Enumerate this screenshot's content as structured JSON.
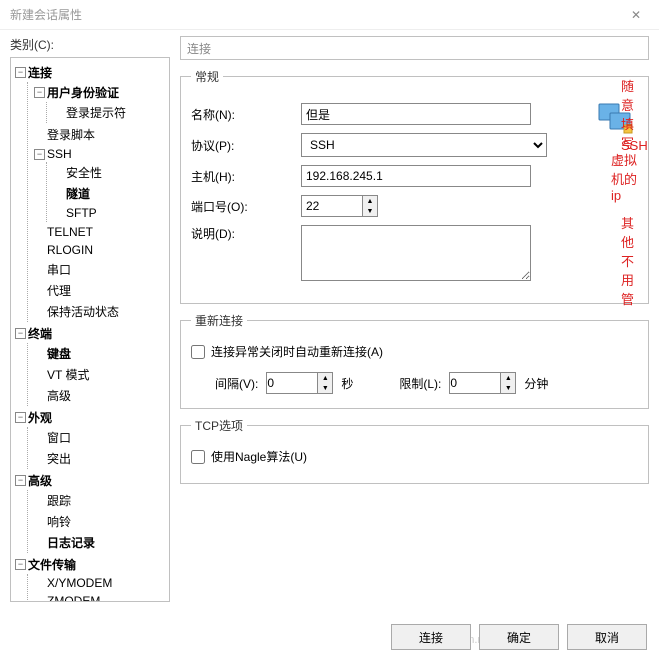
{
  "window": {
    "title": "新建会话属性",
    "close": "✕"
  },
  "sidebar": {
    "label": "类别(C):",
    "tree": {
      "connection": {
        "label": "连接",
        "auth": "用户身份验证",
        "loginPrompt": "登录提示符",
        "loginScript": "登录脚本",
        "ssh": {
          "label": "SSH",
          "security": "安全性",
          "tunnel": "隧道",
          "sftp": "SFTP"
        },
        "telnet": "TELNET",
        "rlogin": "RLOGIN",
        "serial": "串口",
        "proxy": "代理",
        "keepalive": "保持活动状态"
      },
      "terminal": {
        "label": "终端",
        "keyboard": "键盘",
        "vt": "VT 模式",
        "advanced": "高级"
      },
      "appearance": {
        "label": "外观",
        "window": "窗口",
        "highlight": "突出"
      },
      "advanced": {
        "label": "高级",
        "trace": "跟踪",
        "bell": "响铃",
        "logging": "日志记录"
      },
      "filetransfer": {
        "label": "文件传输",
        "xy": "X/YMODEM",
        "z": "ZMODEM"
      }
    }
  },
  "path": "连接",
  "general": {
    "legend": "常规",
    "nameLabel": "名称(N):",
    "nameValue": "但是",
    "nameNote": "随意填写",
    "protoLabel": "协议(P):",
    "protoValue": "SSH",
    "protoNote": "SSH",
    "hostLabel": "主机(H):",
    "hostValue": "192.168.245.1",
    "hostNote": "虚拟机的ip",
    "portLabel": "端口号(O):",
    "portValue": "22",
    "portNote": "其他不用管",
    "descLabel": "说明(D):"
  },
  "reconnect": {
    "legend": "重新连接",
    "checkbox": "连接异常关闭时自动重新连接(A)",
    "intervalLabel": "间隔(V):",
    "intervalValue": "0",
    "sec": "秒",
    "limitLabel": "限制(L):",
    "limitValue": "0",
    "min": "分钟"
  },
  "tcp": {
    "legend": "TCP选项",
    "nagle": "使用Nagle算法(U)"
  },
  "footer": {
    "connect": "连接",
    "ok": "确定",
    "cancel": "取消"
  },
  "watermark": "https://blog.csdn.net/YoonBingChi"
}
